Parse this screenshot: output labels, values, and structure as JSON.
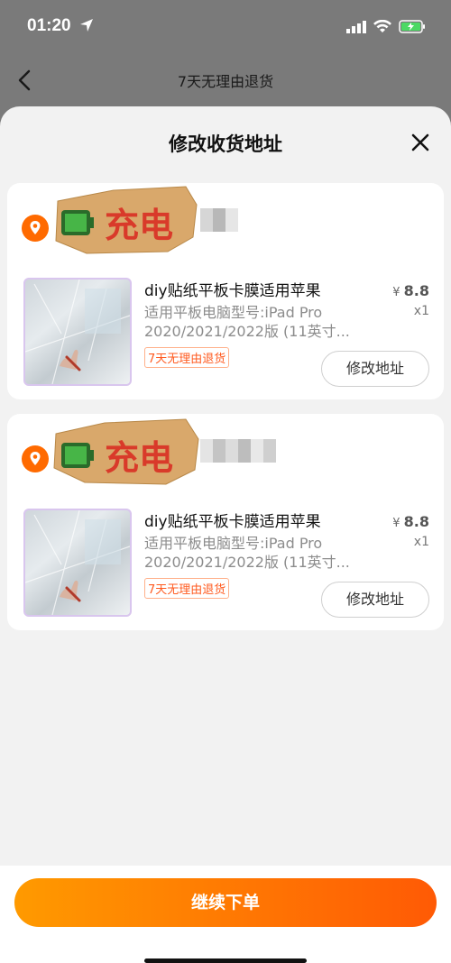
{
  "status": {
    "time": "01:20"
  },
  "nav": {
    "title": "7天无理由退货"
  },
  "sheet": {
    "title": "修改收货地址",
    "cards": [
      {
        "product_title": "diy贴纸平板卡膜适用苹果",
        "spec_line1": "适用平板电脑型号:iPad Pro",
        "spec_line2": "2020/2021/2022版 (11英寸...",
        "tag": "7天无理由退货",
        "price_symbol": "¥",
        "price": "8.8",
        "qty": "x1",
        "edit_label": "修改地址",
        "sticker_text": "充电"
      },
      {
        "product_title": "diy贴纸平板卡膜适用苹果",
        "spec_line1": "适用平板电脑型号:iPad Pro",
        "spec_line2": "2020/2021/2022版 (11英寸...",
        "tag": "7天无理由退货",
        "price_symbol": "¥",
        "price": "8.8",
        "qty": "x1",
        "edit_label": "修改地址",
        "sticker_text": "充电"
      }
    ],
    "continue_label": "继续下单"
  },
  "colors": {
    "accent": "#ff6a00",
    "tag": "#ff5a1f",
    "location": "#ff6a00"
  },
  "icons": [
    "location-arrow-icon",
    "signal-icon",
    "wifi-icon",
    "battery-charging-icon",
    "back-chevron-icon",
    "close-icon",
    "location-pin-icon"
  ]
}
